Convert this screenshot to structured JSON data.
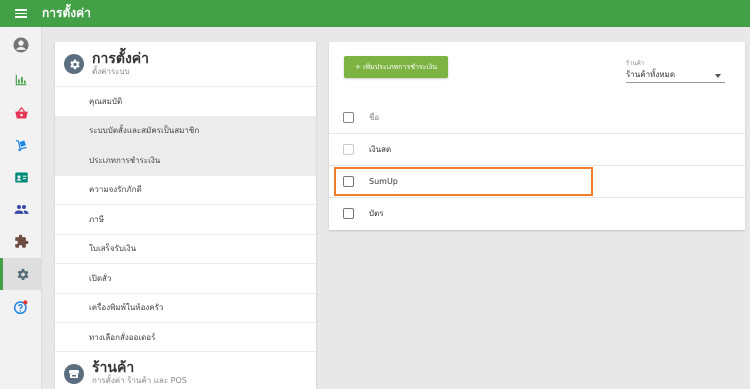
{
  "topbar": {
    "title": "การตั้งค่า"
  },
  "rail": {
    "items": [
      {
        "icon": "account-circle-icon",
        "color": "#757575"
      },
      {
        "icon": "bar-chart-icon",
        "color": "#43a047"
      },
      {
        "icon": "basket-icon",
        "color": "#e53957"
      },
      {
        "icon": "dolly-icon",
        "color": "#1e88e5"
      },
      {
        "icon": "id-card-icon",
        "color": "#00897b"
      },
      {
        "icon": "people-icon",
        "color": "#3949ab"
      },
      {
        "icon": "puzzle-icon",
        "color": "#6d4c41"
      },
      {
        "icon": "gear-icon",
        "color": "#546e7a"
      },
      {
        "icon": "help-icon",
        "color": "#1e88e5"
      }
    ],
    "active_index": 7
  },
  "settings_panel": {
    "header": {
      "title": "การตั้งค่า",
      "subtitle": "ตั้งค่าระบบ"
    },
    "items": [
      "คุณสมบัติ",
      "ระบบบัตสั้งและสมัครเป็นสมาชิก",
      "ประเภทการชำระเงิน",
      "ความจงรักภักดี",
      "ภาษี",
      "ใบเสร็จรับเงิน",
      "เปิดสั่ว",
      "เครื่องพิมพ์ในห้องครัว",
      "ทางเลือกสั่งออเดอร์"
    ],
    "store_header": {
      "title": "ร้านค้า",
      "subtitle": "การตั้งค่า ร้านค้า และ POS"
    }
  },
  "payment_types": {
    "add_button": "+ เพิ่มประเภทการชำระเงิน",
    "store_filter": {
      "label": "ร้านค้า",
      "value": "ร้านค้าทั้งหมด"
    },
    "column_header": "ชื่อ",
    "rows": [
      "เงินสด",
      "SumUp",
      "บัตร"
    ]
  },
  "colors": {
    "topbar": "#43a047",
    "add_button": "#7cb342",
    "highlight": "#ef7d2a"
  }
}
